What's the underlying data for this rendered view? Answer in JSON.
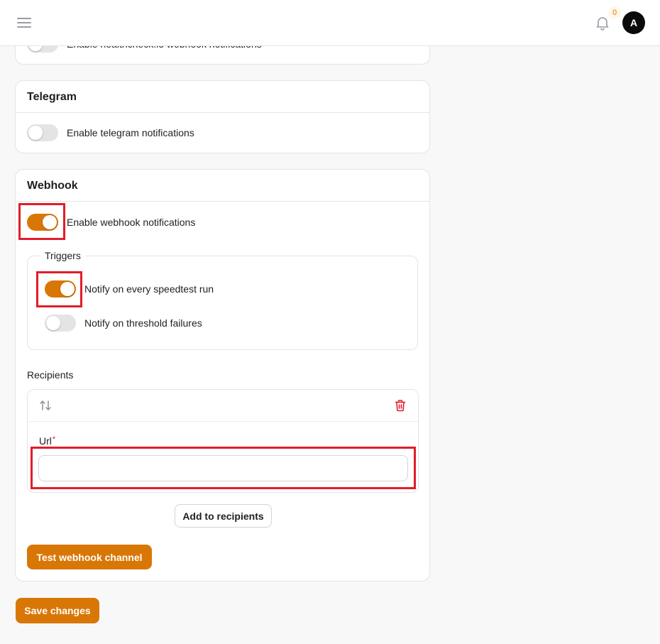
{
  "topbar": {
    "menu_icon": "hamburger-icon",
    "bell_icon": "bell-icon",
    "notification_count": "0",
    "avatar_initial": "A"
  },
  "healthcheck": {
    "toggle_label": "Enable healthcheck.io webhook notifications",
    "enabled": false
  },
  "telegram": {
    "title": "Telegram",
    "toggle_label": "Enable telegram notifications",
    "enabled": false
  },
  "webhook": {
    "title": "Webhook",
    "toggle_label": "Enable webhook notifications",
    "enabled": true,
    "triggers": {
      "legend": "Triggers",
      "items": [
        {
          "label": "Notify on every speedtest run",
          "enabled": true
        },
        {
          "label": "Notify on threshold failures",
          "enabled": false
        }
      ]
    },
    "recipients": {
      "label": "Recipients",
      "url_label": "Url",
      "required_mark": "*",
      "url_value": "",
      "sort_icon": "sort-arrows-icon",
      "delete_icon": "trash-icon",
      "add_button": "Add to recipients"
    },
    "test_button": "Test webhook channel"
  },
  "save_button": "Save changes",
  "colors": {
    "accent": "#d97706",
    "danger": "#e11d2a",
    "highlight_box": "#e11d2a"
  }
}
